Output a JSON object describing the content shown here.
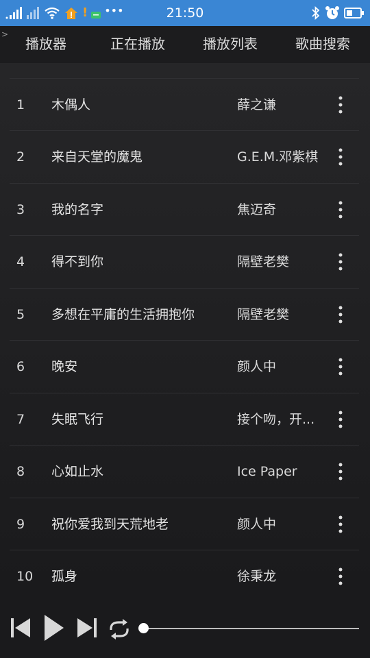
{
  "status_bar": {
    "time": "21:50",
    "left_icons": [
      "signal-icon",
      "signal-icon",
      "wifi-icon",
      "home-alert-icon",
      "message-icon",
      "more-dots-icon"
    ],
    "right_icons": [
      "bluetooth-icon",
      "alarm-icon",
      "battery-icon"
    ]
  },
  "nav": {
    "corner_mark": ">",
    "tabs": [
      {
        "label": "播放器"
      },
      {
        "label": "正在播放"
      },
      {
        "label": "播放列表"
      },
      {
        "label": "歌曲搜索"
      }
    ]
  },
  "songs": [
    {
      "num": "1",
      "title": "木偶人",
      "artist": "薛之谦"
    },
    {
      "num": "2",
      "title": "来自天堂的魔鬼",
      "artist": "G.E.M.邓紫棋"
    },
    {
      "num": "3",
      "title": "我的名字",
      "artist": "焦迈奇"
    },
    {
      "num": "4",
      "title": "得不到你",
      "artist": "隔壁老樊"
    },
    {
      "num": "5",
      "title": "多想在平庸的生活拥抱你",
      "artist": "隔壁老樊"
    },
    {
      "num": "6",
      "title": "晚安",
      "artist": "颜人中"
    },
    {
      "num": "7",
      "title": "失眠飞行",
      "artist": "接个吻，开..."
    },
    {
      "num": "8",
      "title": "心如止水",
      "artist": "Ice Paper"
    },
    {
      "num": "9",
      "title": "祝你爱我到天荒地老",
      "artist": "颜人中"
    },
    {
      "num": "10",
      "title": "孤身",
      "artist": "徐秉龙"
    }
  ],
  "row_icon": "more-vertical-icon",
  "player": {
    "controls": [
      "previous-icon",
      "play-icon",
      "next-icon",
      "repeat-icon"
    ],
    "progress": 0
  },
  "colors": {
    "status_bar": "#3a86d4",
    "background": "#1e1e20",
    "text": "#e2e2e2"
  }
}
